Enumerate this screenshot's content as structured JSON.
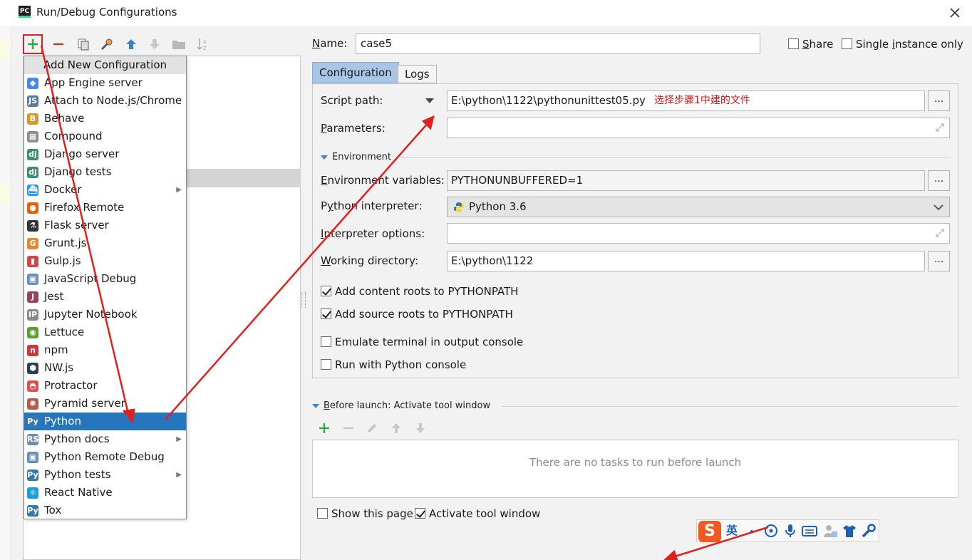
{
  "window": {
    "title": "Run/Debug Configurations",
    "app_icon_text": "PC"
  },
  "popup": {
    "header": "Add New Configuration",
    "items": [
      {
        "label": "App Engine server",
        "icon": "app-engine-icon",
        "color": "#4a86e8",
        "glyph": "◆",
        "submenu": false
      },
      {
        "label": "Attach to Node.js/Chrome",
        "icon": "nodejs-icon",
        "color": "#5c7a9c",
        "glyph": "JS",
        "submenu": false
      },
      {
        "label": "Behave",
        "icon": "behave-icon",
        "color": "#d69a2b",
        "glyph": "B",
        "submenu": false
      },
      {
        "label": "Compound",
        "icon": "compound-icon",
        "color": "#8b8b8b",
        "glyph": "▦",
        "submenu": false
      },
      {
        "label": "Django server",
        "icon": "django-icon",
        "color": "#3b8d6f",
        "glyph": "dj",
        "submenu": false
      },
      {
        "label": "Django tests",
        "icon": "django-tests-icon",
        "color": "#3b8d6f",
        "glyph": "dj",
        "submenu": false
      },
      {
        "label": "Docker",
        "icon": "docker-icon",
        "color": "#2496ed",
        "glyph": "⛴",
        "submenu": true
      },
      {
        "label": "Firefox Remote",
        "icon": "firefox-icon",
        "color": "#e66000",
        "glyph": "●",
        "submenu": false
      },
      {
        "label": "Flask server",
        "icon": "flask-icon",
        "color": "#333333",
        "glyph": "⚗",
        "submenu": false
      },
      {
        "label": "Grunt.js",
        "icon": "grunt-icon",
        "color": "#e48632",
        "glyph": "G",
        "submenu": false
      },
      {
        "label": "Gulp.js",
        "icon": "gulp-icon",
        "color": "#cf4647",
        "glyph": "▮",
        "submenu": false
      },
      {
        "label": "JavaScript Debug",
        "icon": "javascript-debug-icon",
        "color": "#6a8fb5",
        "glyph": "▣",
        "submenu": false
      },
      {
        "label": "Jest",
        "icon": "jest-icon",
        "color": "#99425b",
        "glyph": "J",
        "submenu": false
      },
      {
        "label": "Jupyter Notebook",
        "icon": "jupyter-icon",
        "color": "#8a8a8a",
        "glyph": "IP",
        "submenu": false
      },
      {
        "label": "Lettuce",
        "icon": "lettuce-icon",
        "color": "#5aa02c",
        "glyph": "◉",
        "submenu": false
      },
      {
        "label": "npm",
        "icon": "npm-icon",
        "color": "#cb3837",
        "glyph": "n",
        "submenu": false
      },
      {
        "label": "NW.js",
        "icon": "nwjs-icon",
        "color": "#2c3e50",
        "glyph": "⬢",
        "submenu": false
      },
      {
        "label": "Protractor",
        "icon": "protractor-icon",
        "color": "#d9534f",
        "glyph": "◓",
        "submenu": false
      },
      {
        "label": "Pyramid server",
        "icon": "pyramid-icon",
        "color": "#b85c4a",
        "glyph": "✺",
        "submenu": false
      },
      {
        "label": "Python",
        "icon": "python-icon",
        "color": "#3776ab",
        "glyph": "Py",
        "submenu": false,
        "selected": true
      },
      {
        "label": "Python docs",
        "icon": "python-docs-icon",
        "color": "#6a8fb5",
        "glyph": "RS",
        "submenu": true
      },
      {
        "label": "Python Remote Debug",
        "icon": "python-remote-debug-icon",
        "color": "#6a8fb5",
        "glyph": "▣",
        "submenu": false
      },
      {
        "label": "Python tests",
        "icon": "python-tests-icon",
        "color": "#3776ab",
        "glyph": "Py",
        "submenu": true
      },
      {
        "label": "React Native",
        "icon": "react-icon",
        "color": "#1e9ed8",
        "glyph": "⚛",
        "submenu": false
      },
      {
        "label": "Tox",
        "icon": "tox-icon",
        "color": "#3776ab",
        "glyph": "Py",
        "submenu": false
      }
    ]
  },
  "form": {
    "name_label_pre": "",
    "name_label_u": "N",
    "name_label_post": "ame:",
    "name_value": "case5",
    "share_u": "S",
    "share_post": "hare",
    "single_pre": "Single ",
    "single_u": "i",
    "single_post": "nstance only",
    "tabs": [
      "Configuration",
      "Logs"
    ],
    "script_path_label": "Script path:",
    "script_path_value": "E:\\python\\1122\\pythonunittest05.py",
    "annotation": "选择步骤1中建的文件",
    "parameters_u": "P",
    "parameters_post": "arameters:",
    "parameters_value": "",
    "environment_section": "Environment",
    "env_vars_u": "E",
    "env_vars_post": "nvironment variables:",
    "env_vars_value": "PYTHONUNBUFFERED=1",
    "interpreter_pre": "P",
    "interpreter_u": "y",
    "interpreter_post": "thon interpreter:",
    "interpreter_value": "Python 3.6",
    "interp_options_u": "I",
    "interp_options_post": "nterpreter options:",
    "interp_options_value": "",
    "working_dir_u": "W",
    "working_dir_post": "orking directory:",
    "working_dir_value": "E:\\python\\1122",
    "browse_label": "...",
    "checkboxes": [
      {
        "label": "Add content roots to PYTHONPATH",
        "checked": true
      },
      {
        "label": "Add source roots to PYTHONPATH",
        "checked": true
      },
      {
        "label": "Emulate terminal in output console",
        "checked": false
      },
      {
        "label": "Run with Python console",
        "checked": false
      }
    ]
  },
  "before_launch": {
    "title_u": "B",
    "title_post": "efore launch: Activate tool window",
    "empty_text": "There are no tasks to run before launch"
  },
  "bottom": {
    "show_page": "Show this page",
    "activate_tool_window": "Activate tool window"
  },
  "ime": {
    "logo": "S",
    "lang": "英"
  },
  "colors": {
    "accent": "#2675bf",
    "annotation": "#cc1a1a",
    "arrow": "#e02020",
    "add_green": "#2aa83a"
  }
}
